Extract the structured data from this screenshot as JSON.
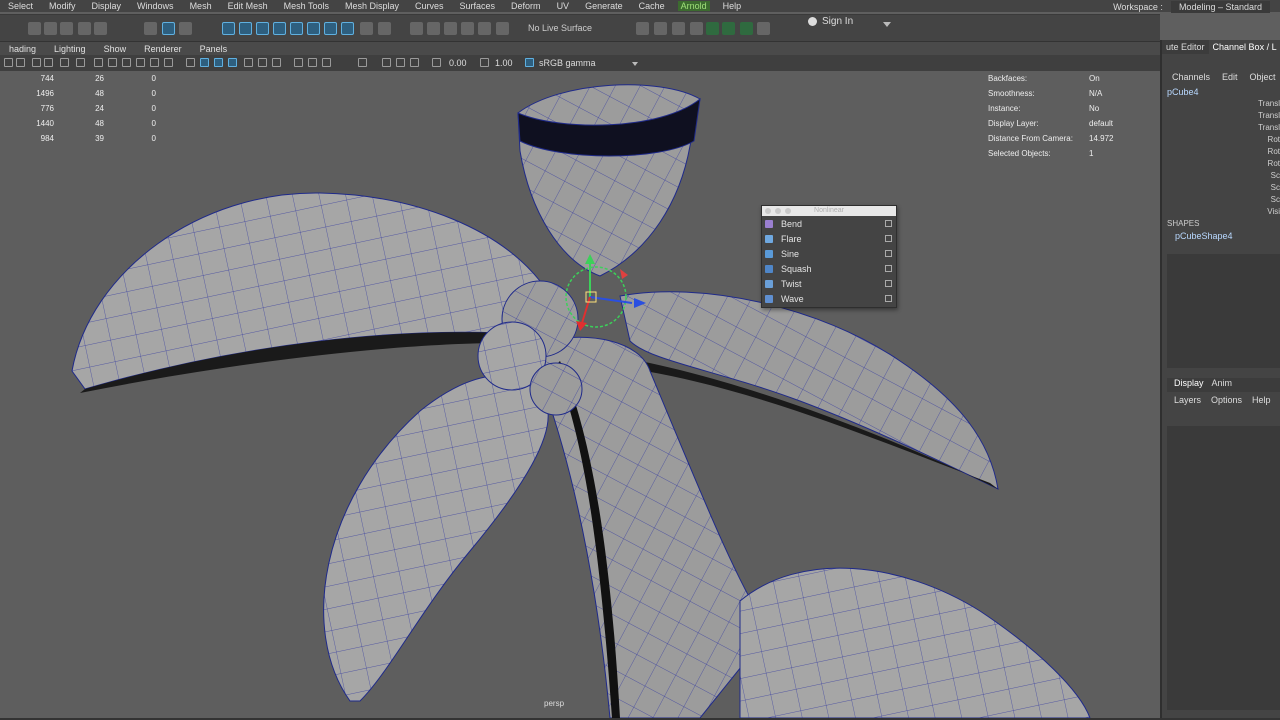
{
  "menubar": [
    "Select",
    "Modify",
    "Display",
    "Windows",
    "Mesh",
    "Edit Mesh",
    "Mesh Tools",
    "Mesh Display",
    "Curves",
    "Surfaces",
    "Deform",
    "UV",
    "Generate",
    "Cache",
    "Arnold",
    "Help"
  ],
  "workspace": {
    "label": "Workspace :",
    "value": "Modeling – Standard"
  },
  "statusline": {
    "live_surface": "No Live Surface",
    "sign_in": "Sign In"
  },
  "panel_menu": [
    "hading",
    "Lighting",
    "Show",
    "Renderer",
    "Panels"
  ],
  "view_toolbar": {
    "exposure": "0.00",
    "gamma": "1.00",
    "color_space": "sRGB gamma"
  },
  "hud_left": [
    [
      "744",
      "26",
      "0"
    ],
    [
      "1496",
      "48",
      "0"
    ],
    [
      "776",
      "24",
      "0"
    ],
    [
      "1440",
      "48",
      "0"
    ],
    [
      "984",
      "39",
      "0"
    ]
  ],
  "hud_right": [
    [
      "Backfaces:",
      "On"
    ],
    [
      "Smoothness:",
      "N/A"
    ],
    [
      "Instance:",
      "No"
    ],
    [
      "Display Layer:",
      "default"
    ],
    [
      "Distance From Camera:",
      "14.972"
    ],
    [
      "Selected Objects:",
      "1"
    ]
  ],
  "camera_label": "persp",
  "nonlinear_menu": {
    "title": "Nonlinear",
    "items": [
      {
        "label": "Bend",
        "icon": "bend-icon",
        "color": "#9a7fd0"
      },
      {
        "label": "Flare",
        "icon": "flare-icon",
        "color": "#6fa8e0"
      },
      {
        "label": "Sine",
        "icon": "sine-icon",
        "color": "#5a9ad8"
      },
      {
        "label": "Squash",
        "icon": "squash-icon",
        "color": "#4f86c8"
      },
      {
        "label": "Twist",
        "icon": "twist-icon",
        "color": "#6a9fd8"
      },
      {
        "label": "Wave",
        "icon": "wave-icon",
        "color": "#5f8fd0"
      }
    ]
  },
  "right_panel": {
    "tabs": [
      "ute Editor",
      "Channel Box / L"
    ],
    "menu": [
      "Channels",
      "Edit",
      "Object"
    ],
    "object": "pCube4",
    "attrs": [
      "Transl",
      "Transl",
      "Transl",
      "Rot",
      "Rot",
      "Rot",
      "Sc",
      "Sc",
      "Sc",
      "Visi"
    ],
    "shapes_header": "SHAPES",
    "shape": "pCubeShape4",
    "display_tabs": [
      "Display",
      "Anim"
    ],
    "display_menu": [
      "Layers",
      "Options",
      "Help"
    ]
  },
  "colors": {
    "accent": "#5fb0e0",
    "selected_text": "#b8d8ff",
    "wire": "#1f2a8a"
  }
}
